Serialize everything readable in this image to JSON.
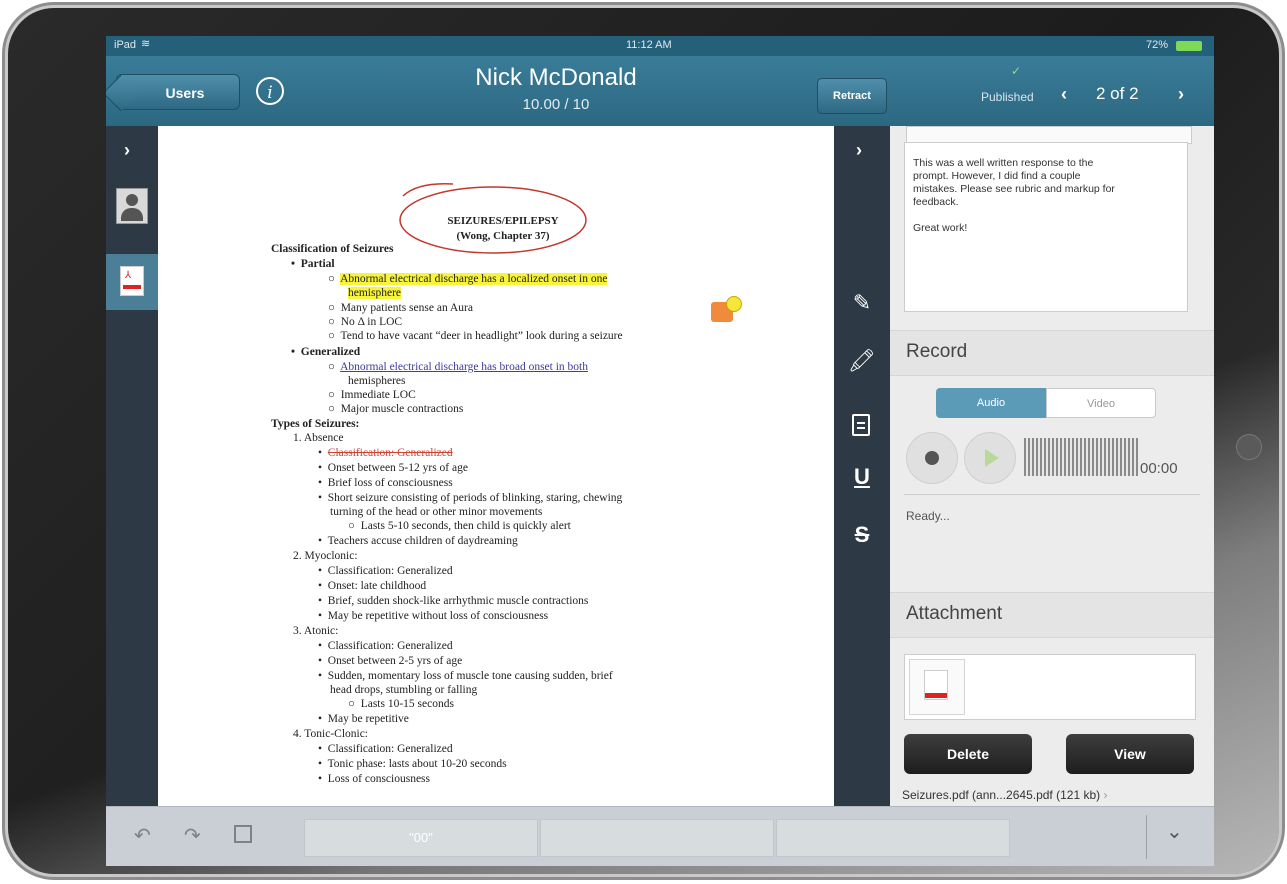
{
  "status": {
    "left": "iPad",
    "time": "11:12 AM",
    "battery": "72%"
  },
  "nav": {
    "back_label": "Users",
    "info_icon": "info-icon",
    "student_name": "Nick McDonald",
    "score": "10.00 / 10",
    "retract_label": "Retract",
    "published_label": "Published",
    "page_count": "2 of 2"
  },
  "document": {
    "title_line1": "SEIZURES/EPILEPSY",
    "title_line2": "(Wong, Chapter 37)",
    "classification_heading": "Classification of Seizures",
    "partial_heading": "Partial",
    "partial_items": [
      "Abnormal electrical discharge has a localized onset in one",
      "hemisphere",
      "Many patients sense an Aura",
      "No Δ in LOC",
      "Tend to have vacant “deer in headlight” look during a seizure"
    ],
    "generalized_heading": "Generalized",
    "generalized_items": [
      "Abnormal electrical discharge has broad onset in both",
      "hemispheres",
      "Immediate LOC",
      "Major muscle contractions"
    ],
    "types_heading": "Types of Seizures:",
    "absence_label": "1. Absence",
    "absence_items": [
      "Classification: Generalized",
      "Onset between 5-12 yrs of age",
      "Brief loss of consciousness",
      "Short seizure consisting of periods of blinking, staring, chewing",
      "turning of the head or other minor movements",
      "Lasts 5-10 seconds, then child is quickly alert",
      "Teachers accuse children of daydreaming"
    ],
    "myoclonic_label": "2. Myoclonic:",
    "myoclonic_items": [
      "Classification: Generalized",
      "Onset: late childhood",
      "Brief, sudden shock-like arrhythmic muscle contractions",
      "May be repetitive without loss of consciousness"
    ],
    "atonic_label": "3. Atonic:",
    "atonic_items": [
      "Classification: Generalized",
      "Onset between 2-5 yrs of age",
      "Sudden, momentary loss of muscle tone causing sudden, brief",
      "head drops, stumbling or falling",
      "Lasts 10-15 seconds",
      "May be repetitive"
    ],
    "tonic_label": "4. Tonic-Clonic:",
    "tonic_items": [
      "Classification: Generalized",
      "Tonic phase: lasts about 10-20 seconds",
      "Loss of consciousness"
    ]
  },
  "feedback": {
    "comment_line1": "This was a well written response to the",
    "comment_line2": "prompt. However, I did find a couple",
    "comment_line3": "mistakes. Please see rubric and markup for",
    "comment_line4": "feedback.",
    "comment_line5": "Great work!"
  },
  "record": {
    "heading": "Record",
    "tab_audio": "Audio",
    "tab_video": "Video",
    "timer": "00:00",
    "status": "Ready..."
  },
  "attachment": {
    "heading": "Attachment",
    "delete_label": "Delete",
    "view_label": "View",
    "file_name": "Seizures.pdf (ann...2645.pdf (121 kb)"
  },
  "bottom": {
    "quick_comment": "\"00\""
  },
  "colors": {
    "nav": "#2f6d88",
    "highlight": "#f7f43a",
    "annotation_red": "#c0392b",
    "audio_tab": "#5b9bb8"
  }
}
